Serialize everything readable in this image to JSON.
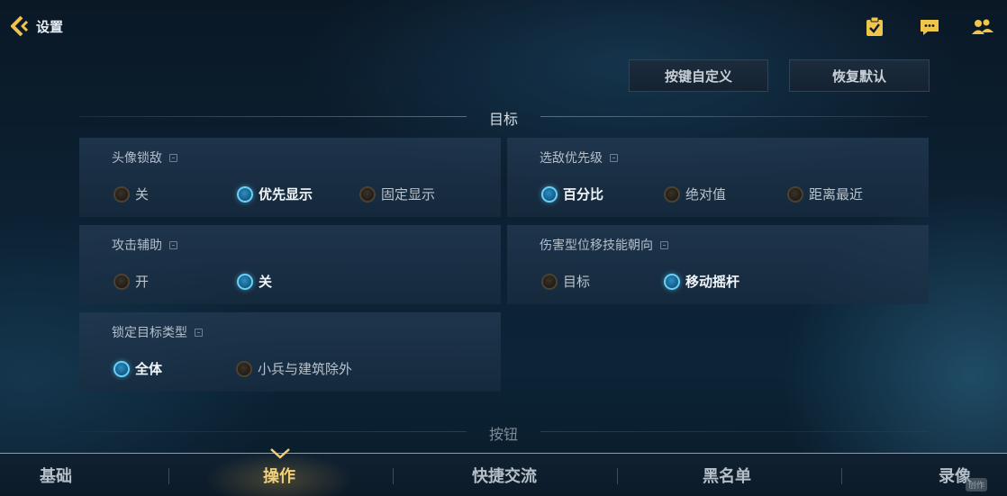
{
  "header": {
    "title": "设置",
    "icons": [
      "task-icon",
      "chat-icon",
      "friends-icon"
    ]
  },
  "toolbar": {
    "custom_keys_label": "按键自定义",
    "restore_default_label": "恢复默认"
  },
  "sections": {
    "target": "目标",
    "buttons": "按钮"
  },
  "panels": [
    {
      "title": "头像锁敌",
      "options": [
        {
          "label": "关",
          "selected": false
        },
        {
          "label": "优先显示",
          "selected": true
        },
        {
          "label": "固定显示",
          "selected": false
        }
      ]
    },
    {
      "title": "选敌优先级",
      "options": [
        {
          "label": "百分比",
          "selected": true
        },
        {
          "label": "绝对值",
          "selected": false
        },
        {
          "label": "距离最近",
          "selected": false
        }
      ]
    },
    {
      "title": "攻击辅助",
      "options": [
        {
          "label": "开",
          "selected": false
        },
        {
          "label": "关",
          "selected": true
        }
      ]
    },
    {
      "title": "伤害型位移技能朝向",
      "options": [
        {
          "label": "目标",
          "selected": false
        },
        {
          "label": "移动摇杆",
          "selected": true
        }
      ]
    },
    {
      "title": "锁定目标类型",
      "options": [
        {
          "label": "全体",
          "selected": true
        },
        {
          "label": "小兵与建筑除外",
          "selected": false
        }
      ]
    }
  ],
  "tabs": [
    {
      "label": "基础",
      "active": false
    },
    {
      "label": "操作",
      "active": true
    },
    {
      "label": "快捷交流",
      "active": false
    },
    {
      "label": "黑名单",
      "active": false
    },
    {
      "label": "录像",
      "active": false
    }
  ],
  "watermark": "创作",
  "colors": {
    "accent_gold": "#f0cf7a",
    "radio_on": "#6ad0f6",
    "panel_bg": "#233a52"
  }
}
